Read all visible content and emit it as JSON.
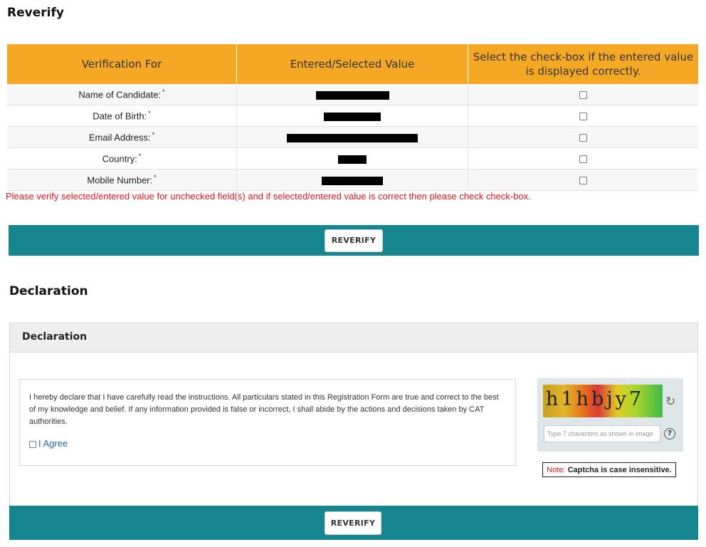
{
  "reverify": {
    "title": "Reverify",
    "columns": [
      "Verification For",
      "Entered/Selected Value",
      "Select the check-box if the entered value is displayed correctly."
    ],
    "rows": [
      {
        "label": "Name of Candidate:",
        "required": "*",
        "value": "[redacted]"
      },
      {
        "label": "Date of Birth:",
        "required": "*",
        "value": "[redacted]"
      },
      {
        "label": "Email Address:",
        "required": "*",
        "value": "[redacted]"
      },
      {
        "label": "Country:",
        "required": "*",
        "value": "[redacted]"
      },
      {
        "label": "Mobile Number:",
        "required": "*",
        "value": "[redacted]"
      }
    ],
    "warning": "Please verify selected/entered value for unchecked field(s) and if selected/entered value is correct then please check check-box.",
    "button_label": "REVERIFY"
  },
  "declaration": {
    "title": "Declaration",
    "panel_title": "Declaration",
    "text": "I hereby declare that I have carefully read the instructions. All particulars stated in this Registration Form are true and correct to the best of my knowledge and belief. If any information provided is false or incorrect, I shall abide by the actions and decisions taken by CAT authorities.",
    "agree_label": "I Agree",
    "captcha": {
      "text": "h1hbjy7",
      "placeholder": "Type 7 characters as shown in image",
      "help": "?",
      "refresh_icon": "refresh-icon"
    },
    "note_label": "Note:",
    "note_text": "Captcha is case insensitive.",
    "button_label": "REVERIFY"
  },
  "colors": {
    "table_header": "#f5a823",
    "action_bar": "#15858f",
    "warning": "#e0141e",
    "link": "#2a5fa6"
  }
}
